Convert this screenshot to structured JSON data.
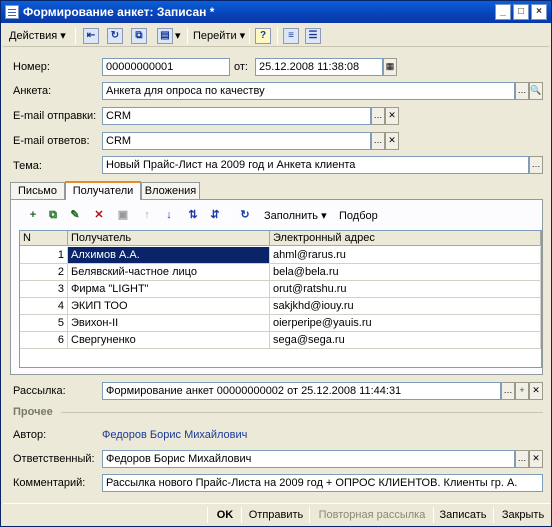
{
  "window": {
    "title": "Формирование анкет: Записан *"
  },
  "toolbar": {
    "actions_label": "Действия",
    "goto_label": "Перейти",
    "help_label": "?"
  },
  "form": {
    "number_label": "Номер:",
    "number_value": "00000000001",
    "from_label": "от:",
    "date_value": "25.12.2008 11:38:08",
    "survey_label": "Анкета:",
    "survey_value": "Анкета для опроса по качеству",
    "email_send_label": "E-mail отправки:",
    "email_send_value": "CRM",
    "email_reply_label": "E-mail ответов:",
    "email_reply_value": "CRM",
    "subject_label": "Тема:",
    "subject_value": "Новый Прайс-Лист на 2009 год и Анкета клиента"
  },
  "tabs": [
    {
      "label": "Письмо"
    },
    {
      "label": "Получатели"
    },
    {
      "label": "Вложения"
    }
  ],
  "grid_toolbar": {
    "fill_label": "Заполнить",
    "select_label": "Подбор"
  },
  "grid": {
    "columns": [
      "N",
      "Получатель",
      "Электронный адрес"
    ],
    "rows": [
      {
        "n": "1",
        "recipient": "Алхимов А.А.",
        "email": "ahml@rarus.ru"
      },
      {
        "n": "2",
        "recipient": "Белявский-частное лицо",
        "email": "bela@bela.ru"
      },
      {
        "n": "3",
        "recipient": "Фирма \"LIGHT\"",
        "email": "orut@ratshu.ru"
      },
      {
        "n": "4",
        "recipient": "ЭКИП ТОО",
        "email": "sakjkhd@iouy.ru"
      },
      {
        "n": "5",
        "recipient": "Эвихон-II",
        "email": "oierperipe@yauis.ru"
      },
      {
        "n": "6",
        "recipient": "Свергуненко",
        "email": "sega@sega.ru"
      }
    ]
  },
  "mailing": {
    "label": "Рассылка:",
    "value": "Формирование анкет 00000000002 от 25.12.2008 11:44:31"
  },
  "other": {
    "section_title": "Прочее",
    "author_label": "Автор:",
    "author_value": "Федоров Борис Михайлович",
    "responsible_label": "Ответственный:",
    "responsible_value": "Федоров Борис Михайлович",
    "comment_label": "Комментарий:",
    "comment_value": "Рассылка нового Прайс-Листа на 2009 год + ОПРОС КЛИЕНТОВ. Клиенты гр. А."
  },
  "footer": {
    "ok": "OK",
    "send": "Отправить",
    "resend": "Повторная рассылка",
    "save": "Записать",
    "close": "Закрыть"
  },
  "colors": {
    "title_bar": "#0842b8",
    "selection": "#0a246a",
    "link": "#1a3a9a"
  }
}
